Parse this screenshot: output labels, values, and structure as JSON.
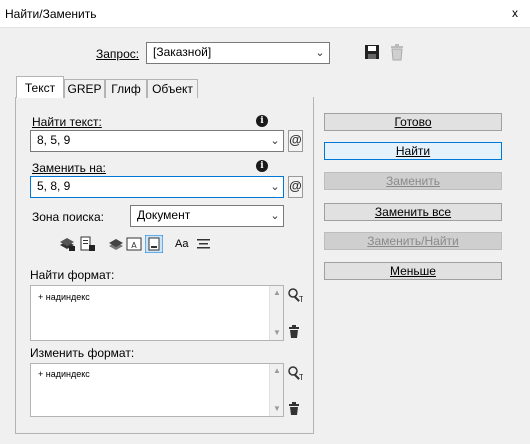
{
  "window": {
    "title": "Найти/Заменить",
    "close_label": "x"
  },
  "query": {
    "label": "Запрос:",
    "value": "[Заказной]"
  },
  "tabs": [
    {
      "label": "Текст",
      "active": true
    },
    {
      "label": "GREP",
      "active": false
    },
    {
      "label": "Глиф",
      "active": false
    },
    {
      "label": "Объект",
      "active": false
    }
  ],
  "find": {
    "label": "Найти текст:",
    "value": "8, 5, 9"
  },
  "replace": {
    "label": "Заменить на:",
    "value": "5, 8, 9"
  },
  "info_symbol": "i",
  "special_char_symbol": "@",
  "search": {
    "label": "Зона поиска:",
    "value": "Документ"
  },
  "options_case_label": "Aa",
  "find_format": {
    "label": "Найти формат:",
    "value": "+ надиндекс"
  },
  "change_format": {
    "label": "Изменить формат:",
    "value": "+ надиндекс"
  },
  "buttons": {
    "done": "Готово",
    "find": "Найти",
    "replace": "Заменить",
    "replace_all": "Заменить все",
    "replace_find": "Заменить/Найти",
    "fewer": "Меньше"
  },
  "colors": {
    "accent": "#0078d7",
    "disabled_text": "#8a8a8a"
  }
}
